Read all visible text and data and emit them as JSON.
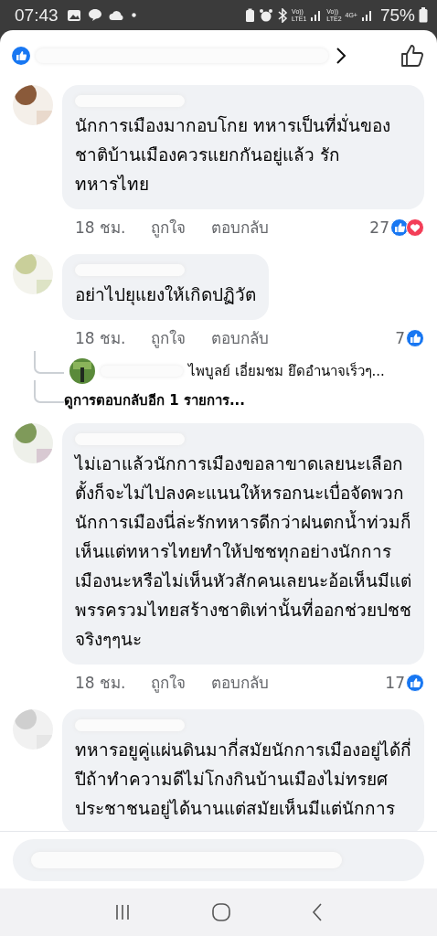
{
  "status_bar": {
    "time": "07:43",
    "sims": [
      {
        "top": "Vo))",
        "bottom": "LTE1"
      },
      {
        "top": "Vo))",
        "bottom": "LTE2",
        "network": "4G+"
      }
    ],
    "battery": "75%"
  },
  "comments": [
    {
      "text": "นักการเมืองมากอบโกย ทหารเป็นที่มั่นของชาติบ้านเมืองควรแยกกันอยู่แล้ว  รักทหารไทย",
      "time": "18 ชม.",
      "like": "ถูกใจ",
      "reply": "ตอบกลับ",
      "count": "27",
      "reactions": [
        {
          "kind": "like"
        },
        {
          "kind": "love"
        }
      ]
    },
    {
      "text": "อย่าไปยุแยงให้เกิดปฏิวัต",
      "time": "18 ชม.",
      "like": "ถูกใจ",
      "reply": "ตอบกลับ",
      "count": "7",
      "reactions": [
        {
          "kind": "like"
        }
      ],
      "replies": [
        {
          "text": "ไพบูลย์ เอี่ยมชม ยึดอำนาจเร็วๆ..."
        }
      ],
      "more_replies": "ดูการตอบกลับอีก 1 รายการ..."
    },
    {
      "text": "ไม่เอาแล้วนักการเมืองขอลาขาดเลยนะเลือกตั้งก็จะไม่ไปลงคะแนนให้หรอกนะเบื่อจัดพวกนักการเมืองนี่ล่ะรักทหารดีกว่าฝนตกน้ำท่วมก็เห็นแต่ทหารไทยทำให้ปชชทุกอย่างนักการเมืองนะหรือไม่เห็นหัวสักคนเลยนะอ้อเห็นมีแต่พรรครวมไทยสร้างชาติเท่านั้นที่ออกช่วยปชชจริงๆๆนะ",
      "time": "18 ชม.",
      "like": "ถูกใจ",
      "reply": "ตอบกลับ",
      "count": "17",
      "reactions": [
        {
          "kind": "like"
        }
      ]
    },
    {
      "text": "ทหารอยูคู่แผ่นดินมากี่สมัยนักการเมืองอยู่ได้กี่ปีถ้าทำความดีไม่โกงกินบ้านเมืองไม่ทรยศประชาชนอยู่ได้นานแต่สมัยเห็นมีแต่นักการ"
    }
  ]
}
